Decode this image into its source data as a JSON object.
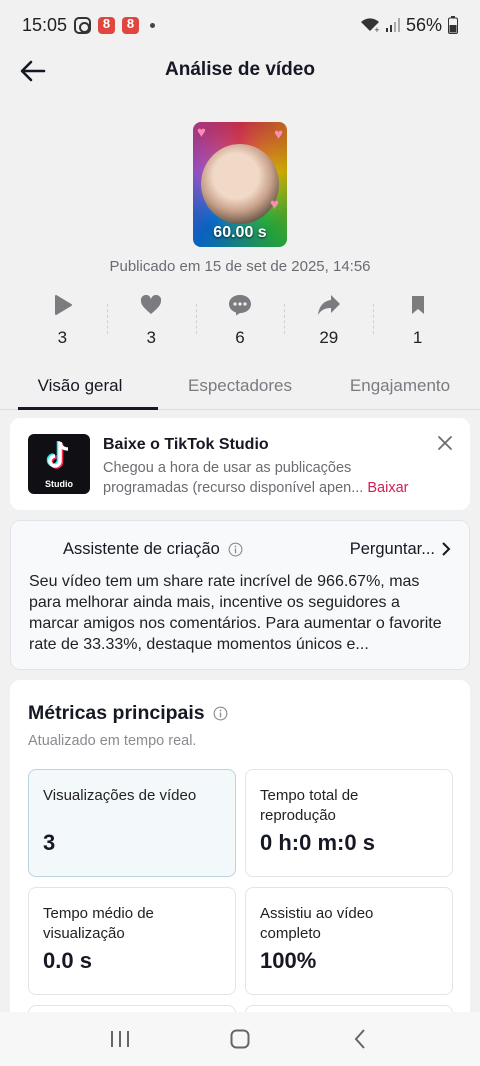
{
  "status_bar": {
    "time": "15:05",
    "battery": "56%",
    "icons": [
      "instagram-icon",
      "app-notification-icon",
      "app-notification-icon",
      "dot-icon",
      "wifi-icon",
      "signal-icon",
      "battery-icon"
    ]
  },
  "header": {
    "title": "Análise de vídeo",
    "back_icon": "arrow-left-icon"
  },
  "video": {
    "duration": "60.00 s",
    "published": "Publicado em 15 de set de 2025, 14:56"
  },
  "stats": [
    {
      "icon": "play-icon",
      "value": "3"
    },
    {
      "icon": "heart-icon",
      "value": "3"
    },
    {
      "icon": "comment-icon",
      "value": "6"
    },
    {
      "icon": "share-icon",
      "value": "29"
    },
    {
      "icon": "bookmark-icon",
      "value": "1"
    }
  ],
  "tabs": [
    {
      "label": "Visão geral",
      "active": true
    },
    {
      "label": "Espectadores",
      "active": false
    },
    {
      "label": "Engajamento",
      "active": false
    }
  ],
  "banner": {
    "title": "Baixe o TikTok Studio",
    "description": "Chegou a hora de usar as publicações programadas (recurso disponível apen...",
    "link": "Baixar",
    "logo_label": "Studio"
  },
  "assistant": {
    "title": "Assistente de criação",
    "ask": "Perguntar...",
    "body": "Seu vídeo tem um share rate incrível de 966.67%, mas para melhorar ainda mais, incentive os seguidores a marcar amigos nos comentários. Para aumentar o favorite rate de 33.33%, destaque momentos únicos e..."
  },
  "metrics": {
    "title": "Métricas principais",
    "subtitle": "Atualizado em tempo real.",
    "cards": [
      {
        "label": "Visualizações de vídeo",
        "value": "3"
      },
      {
        "label": "Tempo total de reprodução",
        "value": "0 h:0 m:0 s"
      },
      {
        "label": "Tempo médio de visualização",
        "value": "0.0 s"
      },
      {
        "label": "Assistiu ao vídeo completo",
        "value": "100%"
      }
    ]
  },
  "colors": {
    "accent": "#d51d55",
    "text": "#161823",
    "muted": "#6b6c72",
    "background": "#f1f1f2"
  }
}
